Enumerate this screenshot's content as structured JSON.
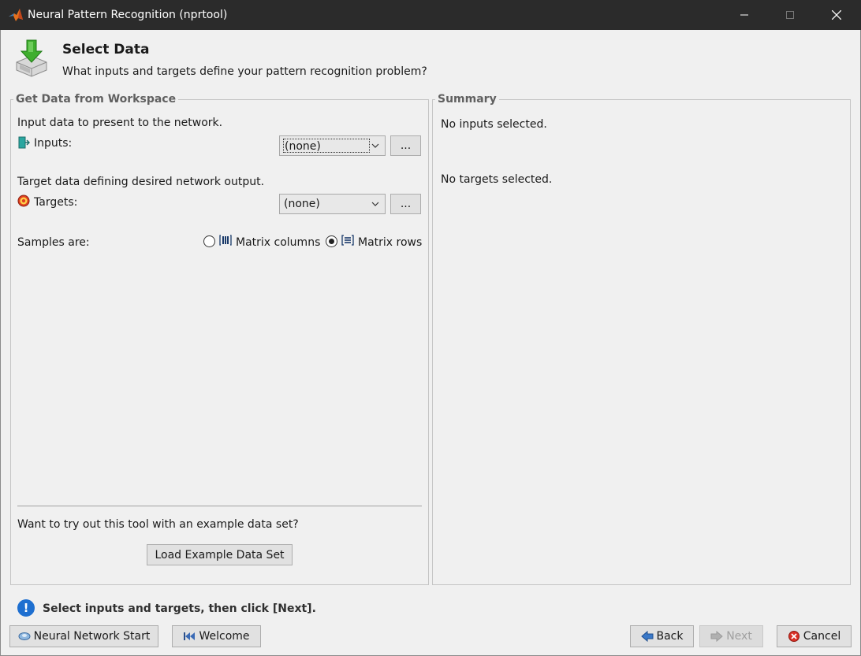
{
  "window": {
    "title": "Neural Pattern Recognition (nprtool)",
    "icons": [
      "matlab-icon",
      "minimize-icon",
      "maximize-icon",
      "close-icon"
    ]
  },
  "header": {
    "title": "Select Data",
    "subtitle": "What inputs and targets define your pattern recognition problem?",
    "icon": "import-data-icon"
  },
  "workspace_panel": {
    "legend": "Get Data from Workspace",
    "inputs_description": "Input data to present to the network.",
    "inputs_label": "Inputs:",
    "inputs_value": "(none)",
    "inputs_browse": "...",
    "targets_description": "Target data defining desired network output.",
    "targets_label": "Targets:",
    "targets_value": "(none)",
    "targets_browse": "...",
    "samples_label": "Samples are:",
    "option_columns": "Matrix columns",
    "option_rows": "Matrix rows",
    "selected_option": "Matrix rows",
    "example_prompt": "Want to try out this tool with an example data set?",
    "load_example_button": "Load Example Data Set"
  },
  "summary_panel": {
    "legend": "Summary",
    "inputs_summary": "No inputs selected.",
    "targets_summary": "No targets selected."
  },
  "status": {
    "message": "Select inputs and targets, then click [Next]."
  },
  "footer": {
    "nn_start_label": "Neural Network Start",
    "welcome_label": "Welcome",
    "back_label": "Back",
    "next_label": "Next",
    "cancel_label": "Cancel"
  },
  "colors": {
    "titlebar": "#2b2b2b",
    "background": "#f0f0f0",
    "status_icon": "#1e6fd0",
    "cancel_icon": "#d93025"
  }
}
